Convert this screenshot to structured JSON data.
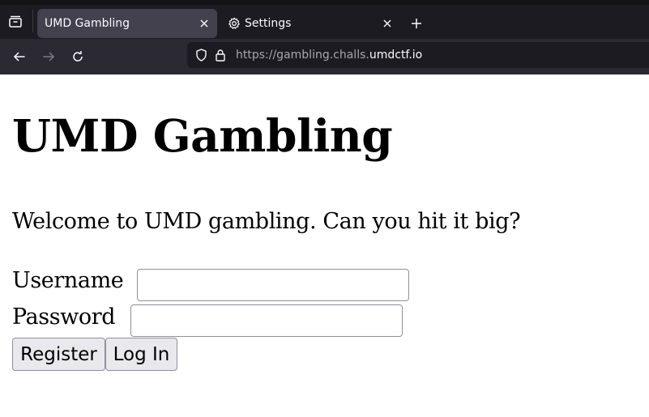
{
  "browser": {
    "tabs": [
      {
        "title": "UMD Gambling",
        "active": true
      },
      {
        "title": "Settings",
        "active": false,
        "icon": "gear-icon"
      }
    ],
    "url": {
      "prefix": "https://gambling.challs.",
      "domain": "umdctf.io"
    },
    "colors": {
      "chrome_bg": "#1c1b22",
      "toolbar_bg": "#2b2a33",
      "active_tab_bg": "#42414d"
    }
  },
  "page": {
    "title": "UMD Gambling",
    "welcome": "Welcome to UMD gambling. Can you hit it big?",
    "form": {
      "username_label": "Username",
      "username_value": "",
      "password_label": "Password",
      "password_value": "",
      "register_label": "Register",
      "login_label": "Log In"
    }
  }
}
